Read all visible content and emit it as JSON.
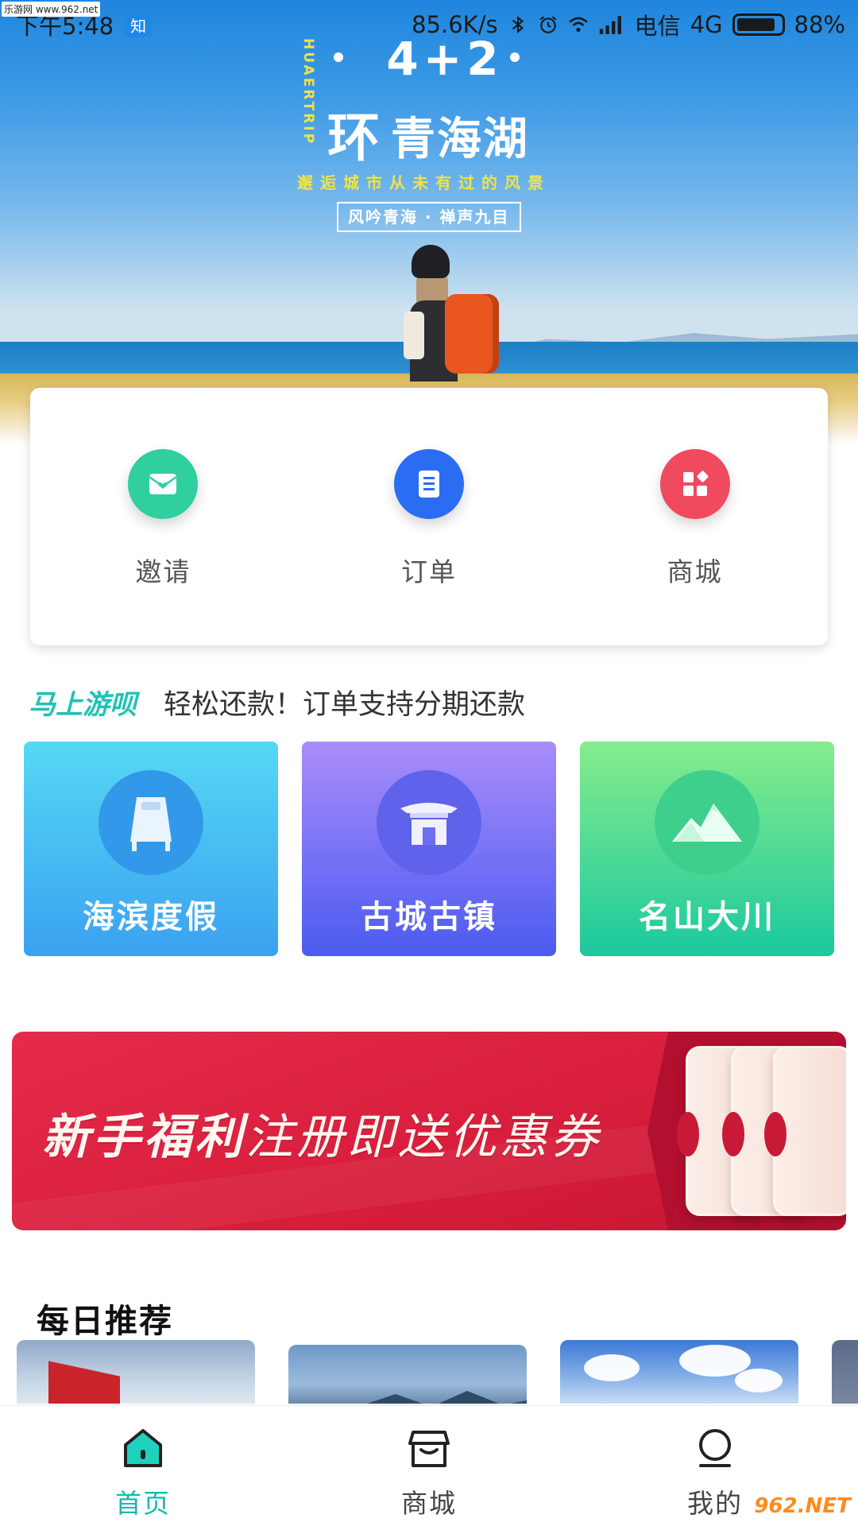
{
  "status_bar": {
    "time": "下午5:48",
    "notification_badge": "知",
    "network_speed": "85.6K/s",
    "carrier": "电信",
    "network_type": "4G",
    "battery": "88%",
    "battery_level": 0.88,
    "icons": [
      "bluetooth-icon",
      "alarm-icon",
      "wifi-icon",
      "signal-icon"
    ]
  },
  "watermarks": {
    "top_left": "乐游网 www.962.net",
    "bottom_right": "962.NET"
  },
  "hero": {
    "big_text": "4+2",
    "ring_char": "环",
    "destination": "青海湖",
    "vertical_text": "HUAERTRIP",
    "subtitle": "邂逅城市从未有过的风景",
    "tag": "风吟青海 · 禅声九目"
  },
  "quick_actions": [
    {
      "label": "邀请",
      "icon": "envelope-heart-icon",
      "color": "#2fcf9f"
    },
    {
      "label": "订单",
      "icon": "document-list-icon",
      "color": "#2a6df3"
    },
    {
      "label": "商城",
      "icon": "shop-grid-icon",
      "color": "#f04a5e"
    }
  ],
  "tagline": {
    "brand": "马上游呗",
    "message": "轻松还款！订单支持分期还款"
  },
  "categories": [
    {
      "label": "海滨度假",
      "icon": "bed-icon"
    },
    {
      "label": "古城古镇",
      "icon": "ancient-gate-icon"
    },
    {
      "label": "名山大川",
      "icon": "mountain-icon"
    }
  ],
  "promo": {
    "bold_text": "新手福利",
    "thin_text": "注册即送优惠券"
  },
  "daily": {
    "title": "每日推荐"
  },
  "tabbar": {
    "tabs": [
      {
        "label": "首页",
        "icon": "home-icon",
        "active": true
      },
      {
        "label": "商城",
        "icon": "store-icon",
        "active": false
      },
      {
        "label": "我的",
        "icon": "profile-icon",
        "active": false
      }
    ],
    "active_color": "#17b9ad"
  }
}
